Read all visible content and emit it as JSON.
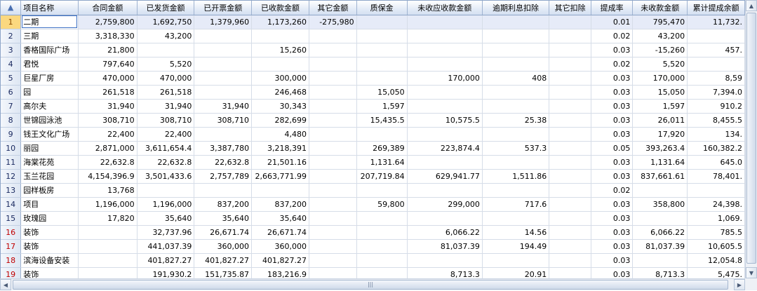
{
  "grid": {
    "corner_icon": "▲",
    "headers": [
      "项目名称",
      "合同金额",
      "已发货金额",
      "已开票金额",
      "已收款金额",
      "其它金额",
      "质保金",
      "未收应收款金额",
      "逾期利息扣除",
      "其它扣除",
      "提成率",
      "未收款金额",
      "累计提成余额"
    ],
    "rows": [
      {
        "n": "1",
        "name": "二期",
        "v": [
          "2,759,800",
          "1,692,750",
          "1,379,960",
          "1,173,260",
          "-275,980",
          "",
          "",
          "",
          "",
          "0.01",
          "795,470",
          "11,732."
        ],
        "sel": true,
        "red": false
      },
      {
        "n": "2",
        "name": "三期",
        "v": [
          "3,318,330",
          "43,200",
          "",
          "",
          "",
          "",
          "",
          "",
          "",
          "0.02",
          "43,200",
          ""
        ],
        "red": false
      },
      {
        "n": "3",
        "name": "香格国际广场",
        "v": [
          "21,800",
          "",
          "",
          "15,260",
          "",
          "",
          "",
          "",
          "",
          "0.03",
          "-15,260",
          "457."
        ],
        "red": false
      },
      {
        "n": "4",
        "name": "君悦",
        "v": [
          "797,640",
          "5,520",
          "",
          "",
          "",
          "",
          "",
          "",
          "",
          "0.02",
          "5,520",
          ""
        ],
        "red": false
      },
      {
        "n": "5",
        "name": "巨星厂房",
        "v": [
          "470,000",
          "470,000",
          "",
          "300,000",
          "",
          "",
          "170,000",
          "408",
          "",
          "0.03",
          "170,000",
          "8,59"
        ],
        "red": false
      },
      {
        "n": "6",
        "name": "园",
        "v": [
          "261,518",
          "261,518",
          "",
          "246,468",
          "",
          "15,050",
          "",
          "",
          "",
          "0.03",
          "15,050",
          "7,394.0"
        ],
        "red": false
      },
      {
        "n": "7",
        "name": "高尔夫",
        "v": [
          "31,940",
          "31,940",
          "31,940",
          "30,343",
          "",
          "1,597",
          "",
          "",
          "",
          "0.03",
          "1,597",
          "910.2"
        ],
        "red": false
      },
      {
        "n": "8",
        "name": "世锦园泳池",
        "v": [
          "308,710",
          "308,710",
          "308,710",
          "282,699",
          "",
          "15,435.5",
          "10,575.5",
          "25.38",
          "",
          "0.03",
          "26,011",
          "8,455.5"
        ],
        "red": false
      },
      {
        "n": "9",
        "name": "钱王文化广场",
        "v": [
          "22,400",
          "22,400",
          "",
          "4,480",
          "",
          "",
          "",
          "",
          "",
          "0.03",
          "17,920",
          "134."
        ],
        "red": false
      },
      {
        "n": "10",
        "name": "丽园",
        "v": [
          "2,871,000",
          "3,611,654.4",
          "3,387,780",
          "3,218,391",
          "",
          "269,389",
          "223,874.4",
          "537.3",
          "",
          "0.05",
          "393,263.4",
          "160,382.2"
        ],
        "red": false
      },
      {
        "n": "11",
        "name": "海棠花苑",
        "v": [
          "22,632.8",
          "22,632.8",
          "22,632.8",
          "21,501.16",
          "",
          "1,131.64",
          "",
          "",
          "",
          "0.03",
          "1,131.64",
          "645.0"
        ],
        "red": false
      },
      {
        "n": "12",
        "name": "玉兰花园",
        "v": [
          "4,154,396.9",
          "3,501,433.6",
          "2,757,789",
          "2,663,771.99",
          "",
          "207,719.84",
          "629,941.77",
          "1,511.86",
          "",
          "0.03",
          "837,661.61",
          "78,401."
        ],
        "red": false
      },
      {
        "n": "13",
        "name": "园样板房",
        "v": [
          "13,768",
          "",
          "",
          "",
          "",
          "",
          "",
          "",
          "",
          "0.02",
          "",
          ""
        ],
        "red": false
      },
      {
        "n": "14",
        "name": "项目",
        "v": [
          "1,196,000",
          "1,196,000",
          "837,200",
          "837,200",
          "",
          "59,800",
          "299,000",
          "717.6",
          "",
          "0.03",
          "358,800",
          "24,398."
        ],
        "red": false
      },
      {
        "n": "15",
        "name": "玫瑰园",
        "v": [
          "17,820",
          "35,640",
          "35,640",
          "35,640",
          "",
          "",
          "",
          "",
          "",
          "0.03",
          "",
          "1,069."
        ],
        "red": false
      },
      {
        "n": "16",
        "name": "装饰",
        "v": [
          "",
          "32,737.96",
          "26,671.74",
          "26,671.74",
          "",
          "",
          "6,066.22",
          "14.56",
          "",
          "0.03",
          "6,066.22",
          "785.5"
        ],
        "red": true
      },
      {
        "n": "17",
        "name": "装饰",
        "v": [
          "",
          "441,037.39",
          "360,000",
          "360,000",
          "",
          "",
          "81,037.39",
          "194.49",
          "",
          "0.03",
          "81,037.39",
          "10,605.5"
        ],
        "red": true
      },
      {
        "n": "18",
        "name": "滨海设备安装",
        "v": [
          "",
          "401,827.27",
          "401,827.27",
          "401,827.27",
          "",
          "",
          "",
          "",
          "",
          "0.03",
          "",
          "12,054.8"
        ],
        "red": true
      },
      {
        "n": "19",
        "name": "装饰",
        "v": [
          "",
          "191,930.2",
          "151,735.87",
          "183,216.9",
          "",
          "",
          "8,713.3",
          "20.91",
          "",
          "0.03",
          "8,713.3",
          "5,475."
        ],
        "red": true
      }
    ]
  },
  "scrollbars": {
    "up_arrow": "▲",
    "down_arrow": "▼",
    "left_arrow": "◀",
    "right_arrow": "▶",
    "grip": "|||"
  }
}
